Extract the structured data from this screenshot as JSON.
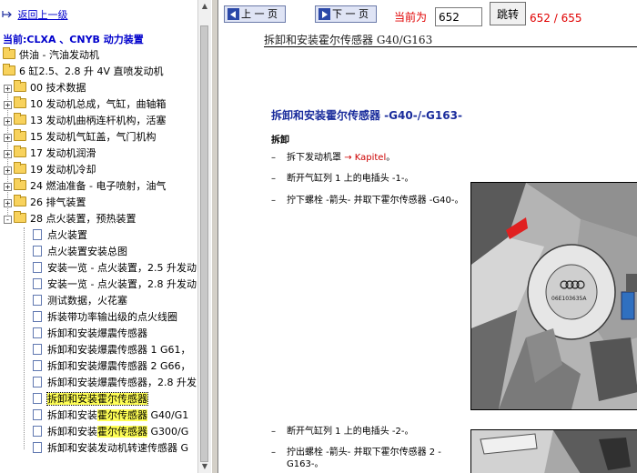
{
  "tree": {
    "back_link": "返回上一级",
    "current_label": "当前:CLXA 、CNYB 动力装置",
    "level1": "供油 - 汽油发动机",
    "level2": "6 缸2.5、2.8 升 4V 直喷发动机",
    "groups": [
      {
        "label": "00 技术数据",
        "toggle": "+"
      },
      {
        "label": "10 发动机总成，气缸，曲轴箱",
        "toggle": "+"
      },
      {
        "label": "13 发动机曲柄连杆机构，活塞",
        "toggle": "+"
      },
      {
        "label": "15 发动机气缸盖，气门机构",
        "toggle": "+"
      },
      {
        "label": "17 发动机润滑",
        "toggle": "+"
      },
      {
        "label": "19 发动机冷却",
        "toggle": "+"
      },
      {
        "label": "24 燃油准备 - 电子喷射，油气",
        "toggle": "+"
      },
      {
        "label": "26 排气装置",
        "toggle": "+"
      },
      {
        "label": "28 点火装置，预热装置",
        "toggle": "-"
      }
    ],
    "docs": [
      {
        "pre": "点火装置",
        "hl": "",
        "post": ""
      },
      {
        "pre": "点火装置安装总图",
        "hl": "",
        "post": ""
      },
      {
        "pre": "安装一览 - 点火装置，2.5 升发动",
        "hl": "",
        "post": ""
      },
      {
        "pre": "安装一览 - 点火装置，2.8 升发动",
        "hl": "",
        "post": ""
      },
      {
        "pre": "测试数据，火花塞",
        "hl": "",
        "post": ""
      },
      {
        "pre": "拆装带功率输出级的点火线圈",
        "hl": "",
        "post": ""
      },
      {
        "pre": "拆卸和安装爆震传感器",
        "hl": "",
        "post": ""
      },
      {
        "pre": "拆卸和安装爆震传感器 1 G61，",
        "hl": "",
        "post": ""
      },
      {
        "pre": "拆卸和安装爆震传感器 2 G66，",
        "hl": "",
        "post": ""
      },
      {
        "pre": "拆卸和安装爆震传感器，2.8 升发",
        "hl": "",
        "post": ""
      },
      {
        "pre": "拆卸和安装",
        "hl": "霍尔传感器",
        "post": ""
      },
      {
        "pre": "拆卸和安装",
        "hl": "霍尔传感器",
        "post": " G40/G1"
      },
      {
        "pre": "拆卸和安装",
        "hl": "霍尔传感器",
        "post": " G300/G"
      },
      {
        "pre": "拆卸和安装发动机转速传感器 G",
        "hl": "",
        "post": ""
      }
    ]
  },
  "toolbar": {
    "prev_label": "上 一 页",
    "next_label": "下 一 页",
    "current_page_label": "当前为",
    "page_value": "652",
    "goto_label": "跳转",
    "page_count": "652 / 655"
  },
  "document": {
    "header": "拆卸和安装霍尔传感器  G40/G163",
    "title": "拆卸和安装霍尔传感器 -G40-/-G163-",
    "section": "拆卸",
    "steps": [
      {
        "dash": "–",
        "text": "拆下发动机罩 ",
        "link": "→ Kapitel",
        "tail": "。"
      },
      {
        "dash": "–",
        "text": "断开气缸列 1 上的电插头 -1-。",
        "link": "",
        "tail": ""
      },
      {
        "dash": "–",
        "text": "拧下螺栓 -箭头- 并取下霍尔传感器 -G40-。",
        "link": "",
        "tail": ""
      },
      {
        "dash": "–",
        "text": "断开气缸列 1 上的电插头 -2-。",
        "link": "",
        "tail": ""
      },
      {
        "dash": "–",
        "text": "拧出螺栓 -箭头- 并取下霍尔传感器 2 -G163-。",
        "link": "",
        "tail": ""
      }
    ],
    "figure_part_number": "06E103635A"
  },
  "colors": {
    "link": "#0000cc",
    "title": "#1a2c9c",
    "page_red": "#e00000",
    "highlight": "#ffff55"
  }
}
